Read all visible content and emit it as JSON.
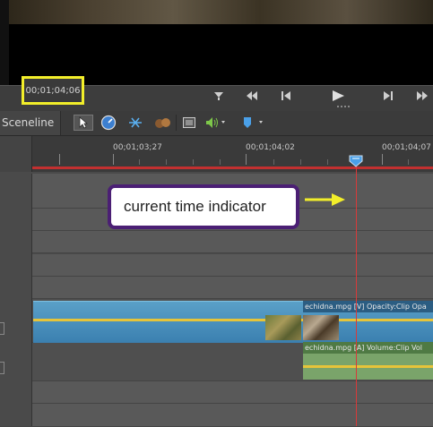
{
  "transport": {
    "timecode": "00;01;04;06"
  },
  "toolbar": {
    "sceneline_label": "Sceneline"
  },
  "ruler": {
    "tick_labels": [
      "00;01;03;27",
      "00;01;04;02",
      "00;01;04;07"
    ]
  },
  "clips": {
    "video_label": "echidna.mpg [V] Opacity:Clip Opa",
    "audio_label": "echidna.mpg [A] Volume:Clip Vol"
  },
  "callout": {
    "text": "current time indicator"
  },
  "colors": {
    "callout_border": "#4b1f74",
    "timecode_highlight": "#f2ee2a",
    "cti": "#d83a3a",
    "arrow": "#f2ee2a",
    "video_clip": "#3b80b0",
    "audio_clip": "#7aa46a"
  },
  "icons": {
    "transport": [
      "set-in-icon",
      "rewind-icon",
      "step-back-icon",
      "play-icon",
      "step-forward-icon",
      "fast-forward-icon"
    ],
    "tools": [
      "selection-tool-icon",
      "clock-icon",
      "split-icon",
      "audio-mix-icon",
      "properties-icon",
      "speaker-icon",
      "marker-icon"
    ]
  }
}
